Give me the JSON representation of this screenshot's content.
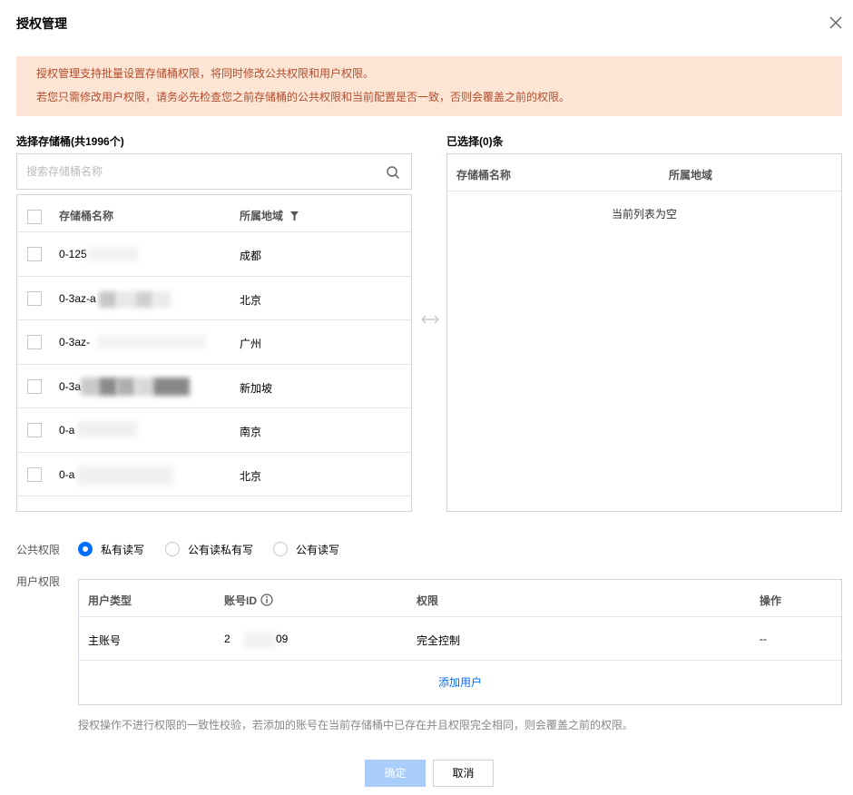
{
  "dialog": {
    "title": "授权管理"
  },
  "notice": {
    "line1": "授权管理支持批量设置存储桶权限，将同时修改公共权限和用户权限。",
    "line2": "若您只需修改用户权限，请务必先检查您之前存储桶的公共权限和当前配置是否一致，否则会覆盖之前的权限。"
  },
  "left": {
    "label": "选择存储桶(共1996个)",
    "search_placeholder": "搜索存储桶名称",
    "columns": [
      "存储桶名称",
      "所属地域"
    ],
    "rows": [
      {
        "name": "0-125",
        "region": "成都"
      },
      {
        "name": "0-3az-a",
        "region": "北京"
      },
      {
        "name": "0-3az-",
        "region": "广州"
      },
      {
        "name": "0-3a",
        "region": "新加坡"
      },
      {
        "name": "0-a",
        "region": "南京"
      },
      {
        "name": "0-a",
        "region": "北京"
      }
    ]
  },
  "right": {
    "label": "已选择(0)条",
    "columns": [
      "存储桶名称",
      "所属地域"
    ],
    "empty": "当前列表为空"
  },
  "public_perm": {
    "label": "公共权限",
    "options": [
      "私有读写",
      "公有读私有写",
      "公有读写"
    ],
    "selected": "私有读写"
  },
  "user_perm": {
    "label": "用户权限",
    "columns": [
      "用户类型",
      "账号ID",
      "权限",
      "操作"
    ],
    "rows": [
      {
        "type": "主账号",
        "id_start": "2",
        "id_end": "09",
        "perm": "完全控制",
        "op": "--"
      }
    ],
    "add_user": "添加用户"
  },
  "note": "授权操作不进行权限的一致性校验，若添加的账号在当前存储桶中已存在并且权限完全相同，则会覆盖之前的权限。",
  "buttons": {
    "ok": "确定",
    "cancel": "取消"
  },
  "colors": {
    "accent": "#006eff",
    "notice_bg": "#fde5d6",
    "notice_text": "#b34d2b",
    "ok_disabled": "#a9cdfb"
  }
}
